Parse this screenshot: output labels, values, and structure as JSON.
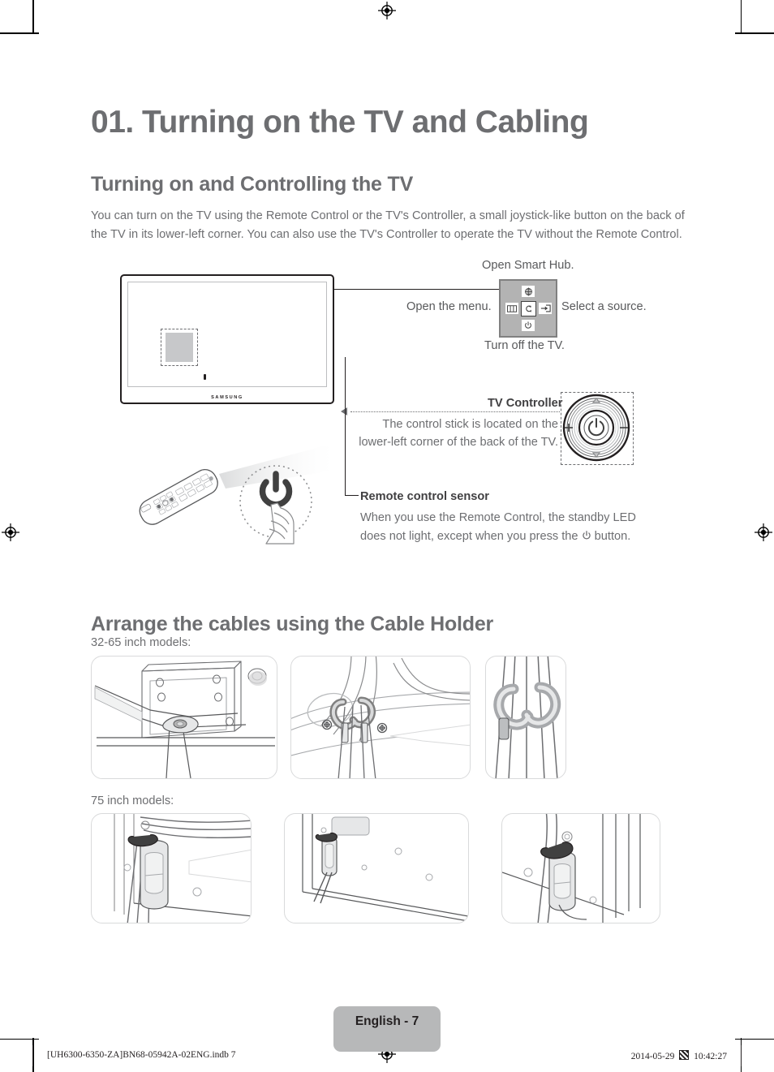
{
  "document": {
    "chapter_title": "01. Turning on the TV and Cabling",
    "section1_heading": "Turning on and Controlling the TV",
    "section1_paragraph": "You can turn on the TV using the Remote Control or the TV's Controller, a small joystick-like button on the back of the TV in its lower-left corner. You can also use the TV's Controller to operate the TV without the Remote Control.",
    "section2_heading": "Arrange the cables using the Cable Holder"
  },
  "tv": {
    "brand_logo": "SAMSUNG"
  },
  "joystick_callouts": {
    "smart_hub": "Open Smart Hub.",
    "menu": "Open the menu.",
    "source": "Select a source.",
    "power_off": "Turn off the TV.",
    "buttons": [
      {
        "position": "top",
        "icon": "smart-hub-icon",
        "action": "Open Smart Hub."
      },
      {
        "position": "left",
        "icon": "menu-icon",
        "action": "Open the menu."
      },
      {
        "position": "center",
        "icon": "return-icon",
        "action": "Select / Return"
      },
      {
        "position": "right",
        "icon": "source-icon",
        "action": "Select a source."
      },
      {
        "position": "bottom",
        "icon": "power-icon",
        "action": "Turn off the TV."
      }
    ]
  },
  "tv_controller": {
    "title": "TV Controller",
    "description": "The control stick is located on the lower-left corner of the back of the TV."
  },
  "remote_sensor": {
    "title": "Remote control sensor",
    "description_part1": "When you use the Remote Control, the standby LED does not light, except when you press the",
    "description_part2": "button.",
    "power_icon": "power-icon"
  },
  "cable_holder": {
    "row1_label": "32-65 inch models:",
    "row2_label": "75 inch models:",
    "row1_images": [
      "tv-back-panel-cable-holder",
      "cable-holder-clips-closeup",
      "cable-holder-detail-zoom"
    ],
    "row2_images": [
      "stand-cable-clip-closeup",
      "stand-rear-overview",
      "stand-cable-clip-detail"
    ]
  },
  "footer": {
    "page_badge": "English - 7",
    "file_reference": "[UH6300-6350-ZA]BN68-05942A-02ENG.indb   7",
    "date": "2014-05-29",
    "time": "10:42:27",
    "glyph": "cjk-box-glyph"
  },
  "colors": {
    "heading": "#6d6e71",
    "body_text": "#6d6e71",
    "callout_bold": "#414042",
    "badge_bg": "#b7b8b9",
    "joystick_bg": "#b3b3b3",
    "tv_outline": "#231f20"
  }
}
